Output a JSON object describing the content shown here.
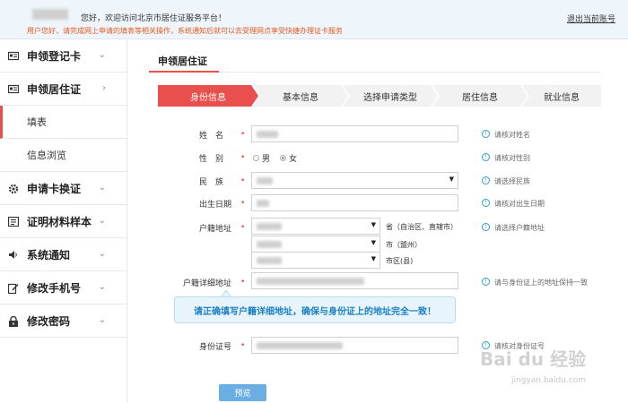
{
  "header": {
    "welcome": "您好，欢迎访问北京市居住证服务平台！",
    "notice": "用户您好，请完成网上申请的填表等相关操作，系统通知后就可以去受理网点享受快捷办理证卡服务",
    "logout": "退出当前账号",
    "colors": {
      "bar": "#eef5fb",
      "notice": "#e35b1f"
    }
  },
  "sidebar": {
    "items": [
      {
        "label": "申领登记卡",
        "icon": "id-card-icon",
        "chevron": "⌄"
      },
      {
        "label": "申领居住证",
        "icon": "card-icon",
        "chevron": "›"
      },
      {
        "label": "填表",
        "icon": "",
        "chevron": ""
      },
      {
        "label": "信息浏览",
        "icon": "",
        "chevron": ""
      },
      {
        "label": "申请卡换证",
        "icon": "gear-icon",
        "chevron": "⌄"
      },
      {
        "label": "证明材料样本",
        "icon": "document-icon",
        "chevron": "⌄"
      },
      {
        "label": "系统通知",
        "icon": "speaker-icon",
        "chevron": "⌄"
      },
      {
        "label": "修改手机号",
        "icon": "edit-icon",
        "chevron": "⌄"
      },
      {
        "label": "修改密码",
        "icon": "lock-icon",
        "chevron": "⌄"
      }
    ]
  },
  "main": {
    "title": "申领居住证",
    "steps": [
      "身份信息",
      "基本信息",
      "选择申请类型",
      "居住信息",
      "就业信息"
    ],
    "accent": "#e9504d",
    "form": {
      "name": {
        "label": "姓　名",
        "hint": "请核对姓名"
      },
      "gender": {
        "label": "性　别",
        "options": [
          "男",
          "女"
        ],
        "selected": "女",
        "hint": "请核对性别"
      },
      "ethnicity": {
        "label": "民　族",
        "hint": "请选择民族"
      },
      "birthdate": {
        "label": "出生日期",
        "hint": "请核对出生日期"
      },
      "household": {
        "label": "户籍地址",
        "suffixes": [
          "省（自治区、直辖市）",
          "市（盟州）",
          "市区(县)"
        ],
        "hint": "请选择户籍地址"
      },
      "household_detail": {
        "label": "户籍详细地址",
        "hint": "请与身份证上的地址保持一致"
      },
      "tooltip": "请正确填写户籍详细地址，确保与身份证上的地址完全一致！",
      "id_number": {
        "label": "身份证号",
        "hint": "请核对身份证号"
      }
    },
    "preview_button": "预览"
  },
  "watermark": {
    "text": "Bai du 经验",
    "sub": "jingyan.baidu.com"
  }
}
